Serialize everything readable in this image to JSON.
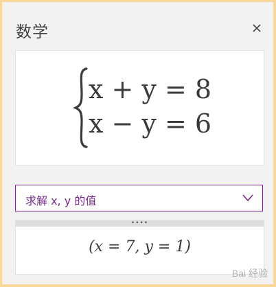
{
  "header": {
    "title": "数学",
    "close_icon": "close-icon"
  },
  "equations": {
    "line1": "x + y = 8",
    "line2": "x − y = 6"
  },
  "dropdown": {
    "selected": "求解 x, y 的值",
    "icon": "chevron-down-icon"
  },
  "result": {
    "handle_glyph": "••••",
    "text": "(x = 7, y = 1)"
  },
  "watermark": {
    "text": "Bai 经验"
  },
  "colors": {
    "accent": "#7a2a8f",
    "frame": "#f8d89a",
    "panel": "#f2f2f2"
  }
}
